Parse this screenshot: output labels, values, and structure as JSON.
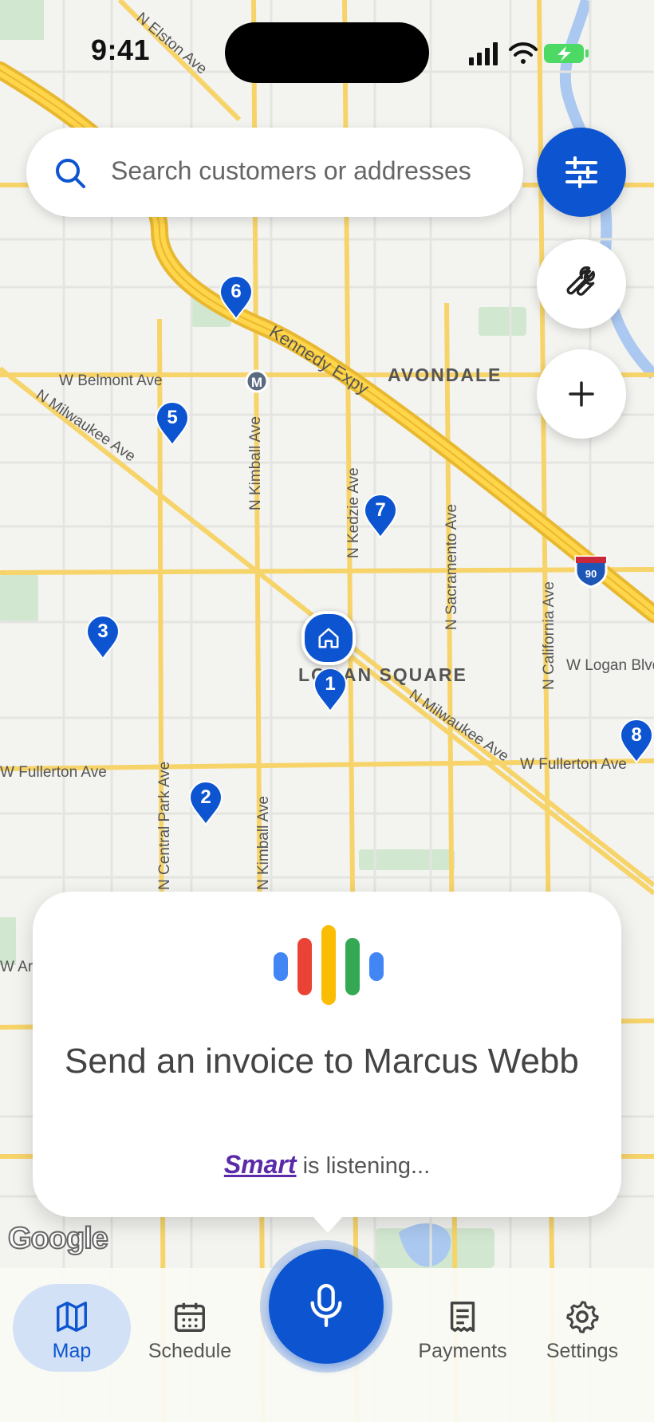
{
  "status_bar": {
    "time": "9:41"
  },
  "search": {
    "placeholder": "Search customers or addresses"
  },
  "map": {
    "street_labels": {
      "elston": "N Elston Ave",
      "belmont": "W Belmont Ave",
      "milwaukee": "N Milwaukee Ave",
      "kimball": "N Kimball Ave",
      "kedzie": "N Kedzie Ave",
      "sacramento": "N Sacramento Ave",
      "california": "N California Ave",
      "kennedy": "Kennedy Expy",
      "fullerton": "W Fullerton Ave",
      "fullerton_right": "W Fullerton Ave",
      "logan_blvd": "W Logan Blvd",
      "milwaukee_se": "N Milwaukee Ave",
      "central_park": "N Central Park Ave",
      "armitage": "W Armitage Ave"
    },
    "neighborhoods": {
      "avondale": "AVONDALE",
      "logan_square": "LOGAN SQUARE"
    },
    "transit_badge": "M",
    "interstate": "90",
    "pins": [
      "1",
      "2",
      "3",
      "5",
      "6",
      "7",
      "8"
    ]
  },
  "voice_card": {
    "transcript": "Send an invoice to Marcus Webb",
    "brand": "Smart",
    "status": "is listening...",
    "bar_colors": [
      "#4285F4",
      "#EA4335",
      "#FBBC04",
      "#34A853",
      "#4285F4"
    ]
  },
  "attribution": "Google",
  "bottom_nav": {
    "items": [
      {
        "label": "Map",
        "active": true
      },
      {
        "label": "Schedule"
      },
      {
        "label": "Payments"
      },
      {
        "label": "Settings"
      }
    ]
  },
  "colors": {
    "accent": "#0d55d0",
    "road_major": "#f5c842",
    "water": "#aac8f0",
    "park": "#cfe6cc"
  }
}
